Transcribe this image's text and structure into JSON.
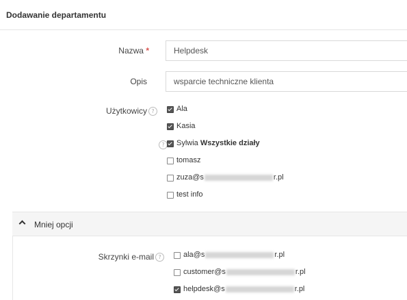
{
  "header": {
    "title": "Dodawanie departamentu"
  },
  "form": {
    "name": {
      "label": "Nazwa",
      "required_mark": "*",
      "value": "Helpdesk"
    },
    "description": {
      "label": "Opis",
      "value": "wsparcie techniczne klienta"
    },
    "users": {
      "label": "Użytkowicy",
      "help_icon": "?",
      "items": [
        {
          "text": "Ala",
          "checked": true
        },
        {
          "text": "Kasia",
          "checked": true
        },
        {
          "text": "Sylwia",
          "suffix_bold": "Wszystkie działy",
          "checked": true,
          "help_icon": "?"
        },
        {
          "text": "tomasz",
          "checked": false
        },
        {
          "text_prefix": "zuza@s",
          "text_suffix": "r.pl",
          "checked": false
        },
        {
          "text": "test info",
          "checked": false
        }
      ]
    }
  },
  "less_options": {
    "label": "Mniej opcji",
    "icon": "chevron-up-icon"
  },
  "mailboxes": {
    "label": "Skrzynki e-mail",
    "help_icon": "?",
    "items": [
      {
        "text_prefix": "ala@s",
        "text_suffix": "r.pl",
        "checked": false
      },
      {
        "text_prefix": "customer@s",
        "text_suffix": "r.pl",
        "checked": false
      },
      {
        "text_prefix": "helpdesk@s",
        "text_suffix": "r.pl",
        "checked": true
      }
    ]
  }
}
